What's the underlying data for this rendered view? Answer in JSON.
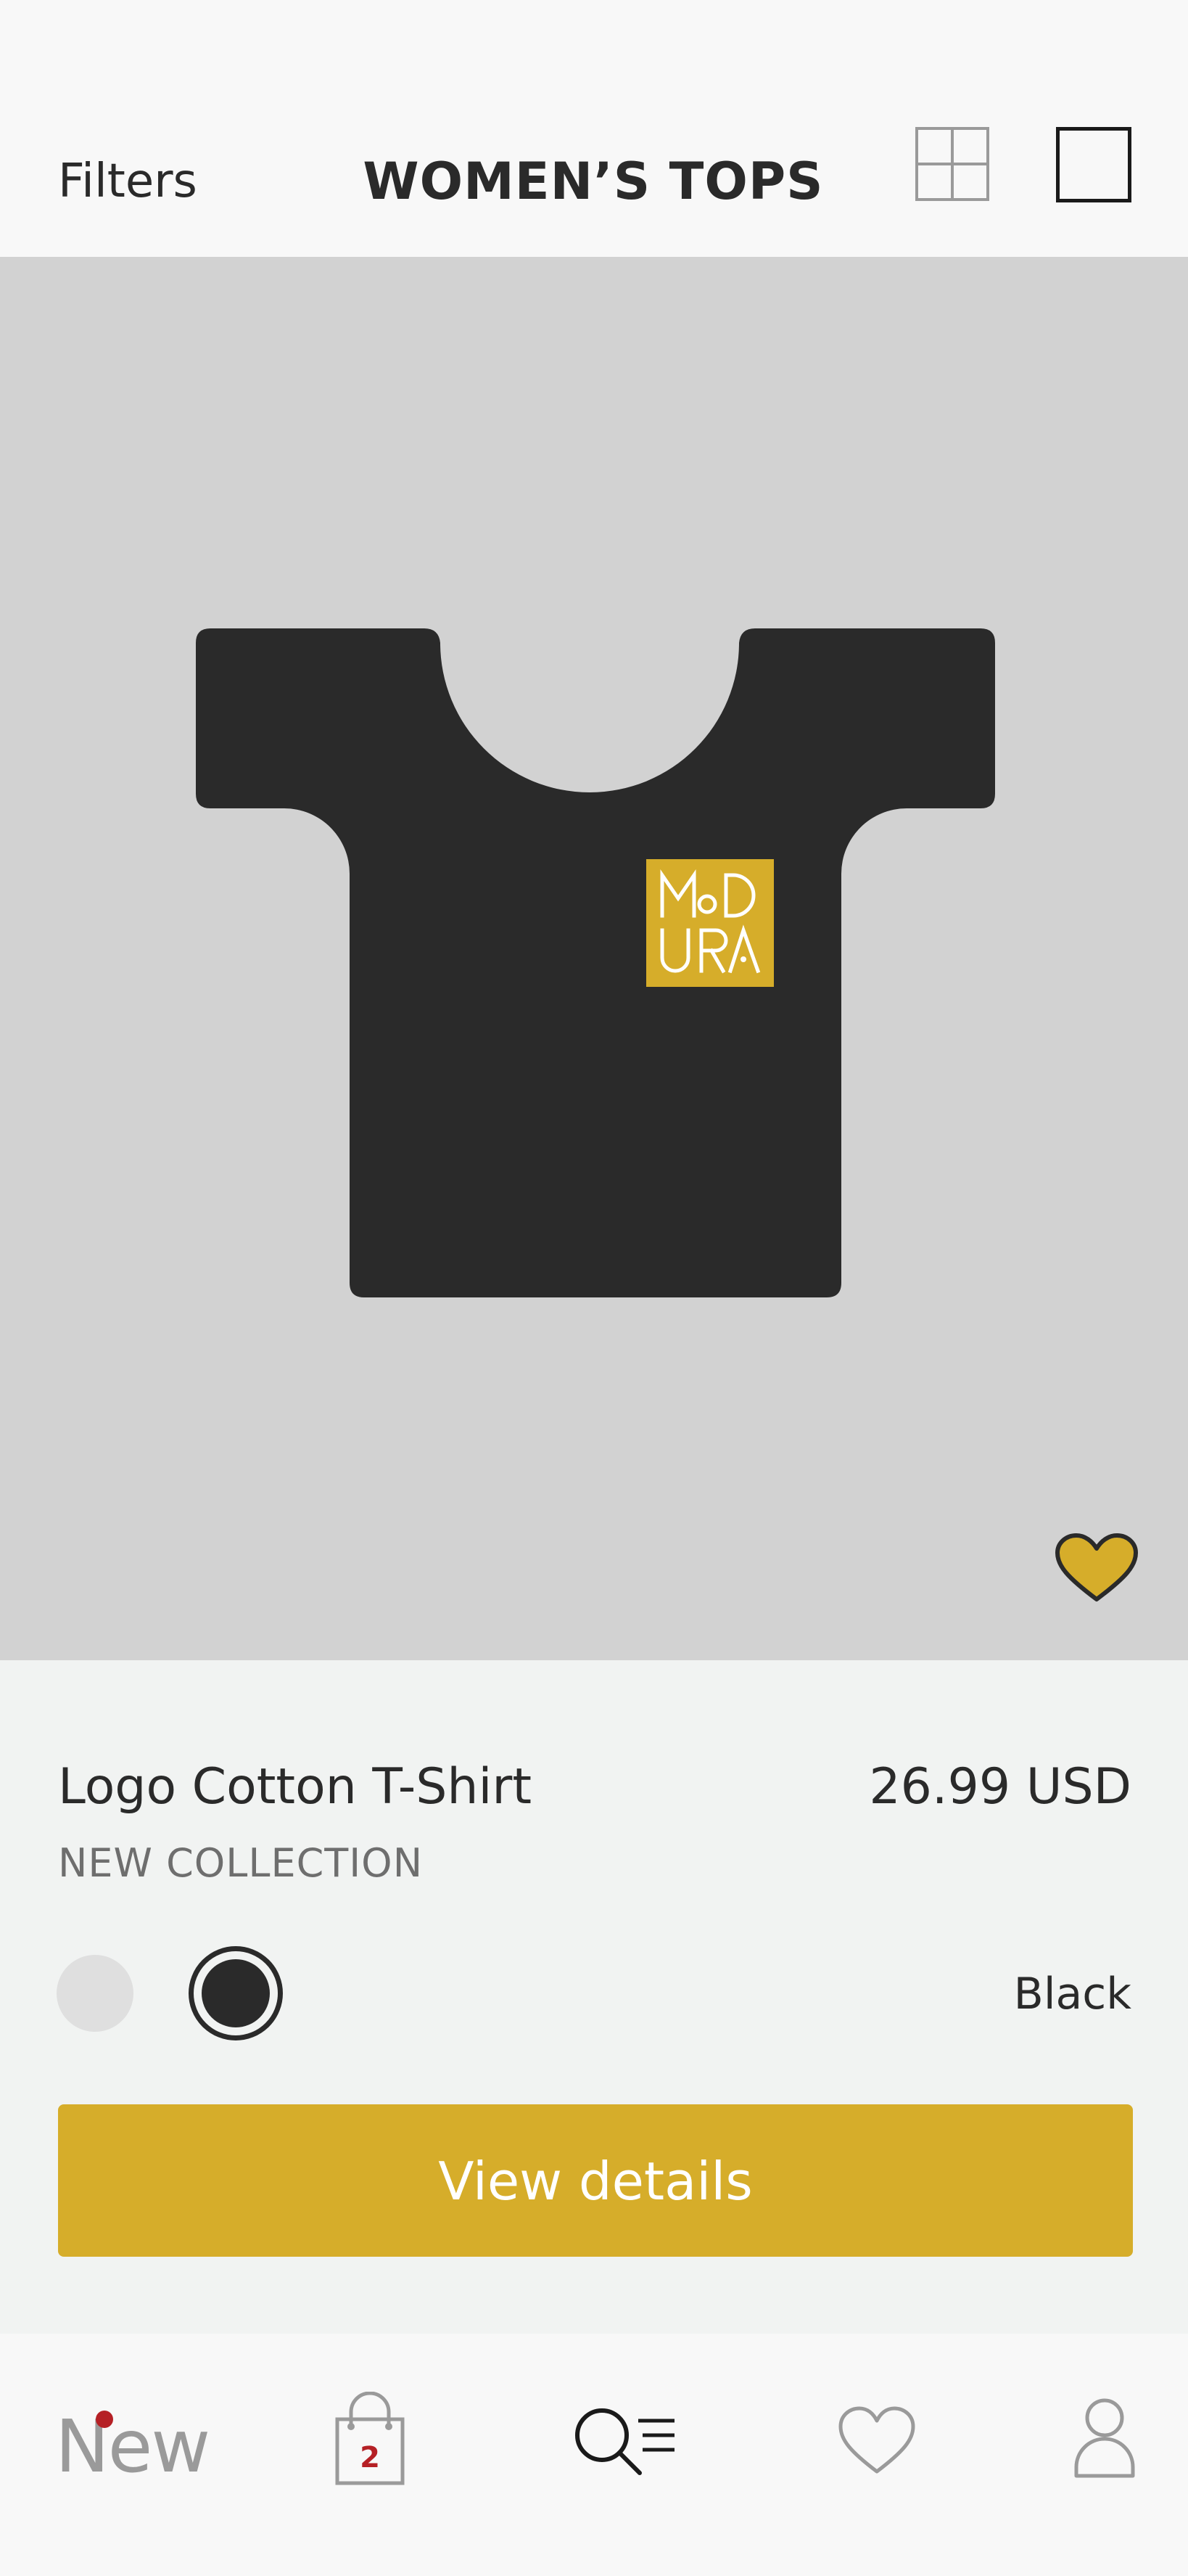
{
  "header": {
    "filters_label": "Filters",
    "title": "WOMEN’S TOPS"
  },
  "product": {
    "name": "Logo Cotton T-Shirt",
    "price": "26.99 USD",
    "collection": "NEW COLLECTION",
    "logo_text": "MODURA",
    "selected_color": "Black",
    "favorited": true,
    "swatches": [
      "light-grey",
      "black"
    ],
    "cta_label": "View details"
  },
  "colors": {
    "accent": "#d6ad2a",
    "shirt": "#2a2a2a",
    "image_background": "#d2d2d2",
    "badge_red": "#b52025"
  },
  "bottom_nav": {
    "new_label": "New",
    "bag_count": "2",
    "items": [
      "new",
      "bag-icon",
      "search-menu-icon",
      "heart-icon",
      "user-icon"
    ]
  }
}
